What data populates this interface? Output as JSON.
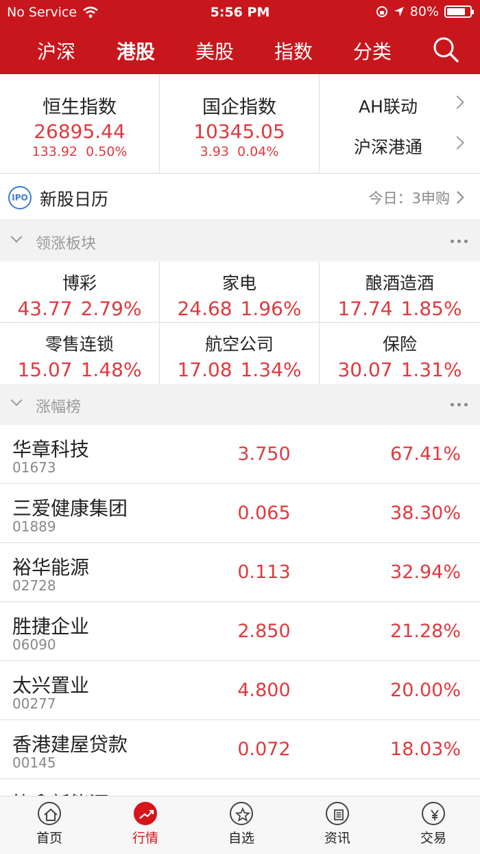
{
  "status": {
    "carrier": "No Service",
    "time": "5:56 PM",
    "battery": "80%",
    "battery_level": 0.8
  },
  "tabs": [
    {
      "label": "沪深",
      "active": false
    },
    {
      "label": "港股",
      "active": true
    },
    {
      "label": "美股",
      "active": false
    },
    {
      "label": "指数",
      "active": false
    },
    {
      "label": "分类",
      "active": false
    }
  ],
  "indices": [
    {
      "name": "恒生指数",
      "value": "26895.44",
      "change": "133.92",
      "pct": "0.50%"
    },
    {
      "name": "国企指数",
      "value": "10345.05",
      "change": "3.93",
      "pct": "0.04%"
    }
  ],
  "links": [
    {
      "label": "AH联动"
    },
    {
      "label": "沪深港通"
    }
  ],
  "ipo": {
    "badge": "IPO",
    "title": "新股日历",
    "today": "今日：3申购"
  },
  "sections": {
    "sectors": "领涨板块",
    "gainers": "涨幅榜"
  },
  "sectors": [
    {
      "name": "博彩",
      "price": "43.77",
      "pct": "2.79%"
    },
    {
      "name": "家电",
      "price": "24.68",
      "pct": "1.96%"
    },
    {
      "name": "酿酒造酒",
      "price": "17.74",
      "pct": "1.85%"
    },
    {
      "name": "零售连锁",
      "price": "15.07",
      "pct": "1.48%"
    },
    {
      "name": "航空公司",
      "price": "17.08",
      "pct": "1.34%"
    },
    {
      "name": "保险",
      "price": "30.07",
      "pct": "1.31%"
    }
  ],
  "gainers": [
    {
      "name": "华章科技",
      "code": "01673",
      "price": "3.750",
      "pct": "67.41%"
    },
    {
      "name": "三爱健康集团",
      "code": "01889",
      "price": "0.065",
      "pct": "38.30%"
    },
    {
      "name": "裕华能源",
      "code": "02728",
      "price": "0.113",
      "pct": "32.94%"
    },
    {
      "name": "胜捷企业",
      "code": "06090",
      "price": "2.850",
      "pct": "21.28%"
    },
    {
      "name": "太兴置业",
      "code": "00277",
      "price": "4.800",
      "pct": "20.00%"
    },
    {
      "name": "香港建屋贷款",
      "code": "00145",
      "price": "0.072",
      "pct": "18.03%"
    },
    {
      "name": "协鑫新能源",
      "code": "",
      "price": "",
      "pct": ""
    }
  ],
  "bottom_nav": [
    {
      "label": "首页",
      "icon": "home-icon",
      "active": false
    },
    {
      "label": "行情",
      "icon": "trend-icon",
      "active": true
    },
    {
      "label": "自选",
      "icon": "star-icon",
      "active": false
    },
    {
      "label": "资讯",
      "icon": "news-icon",
      "active": false
    },
    {
      "label": "交易",
      "icon": "yen-icon",
      "active": false
    }
  ],
  "colors": {
    "brand_red": "#c8161d",
    "up_red": "#e0393e",
    "ipo_blue": "#3a7bd5"
  }
}
